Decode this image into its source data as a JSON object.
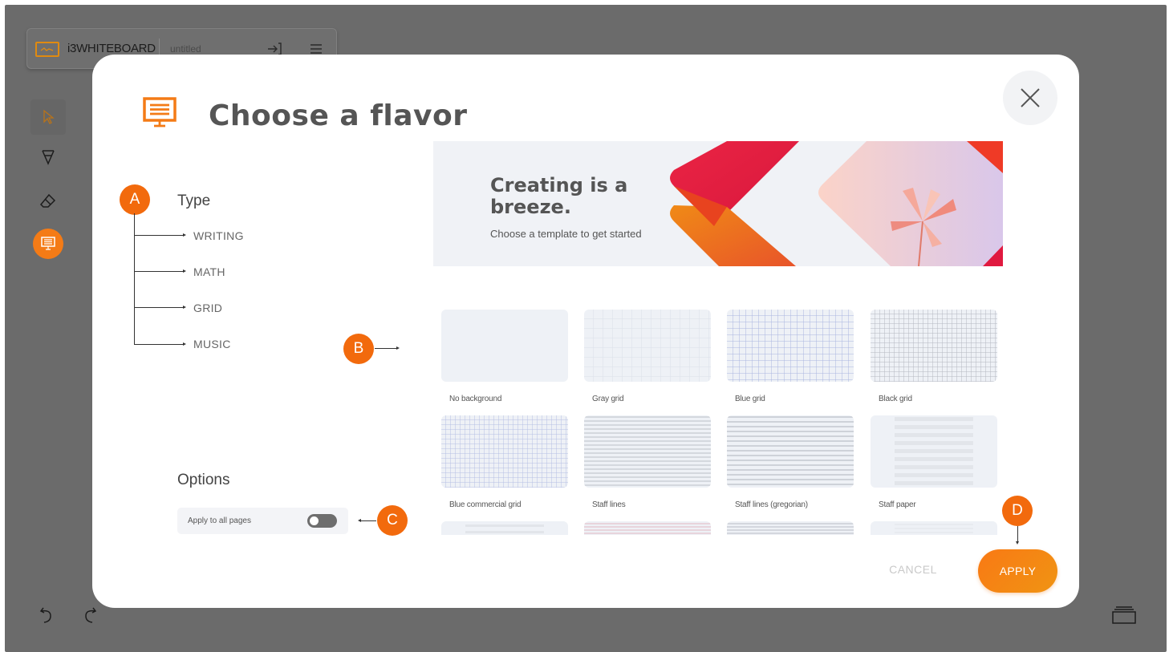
{
  "app": {
    "name": "i3WHITEBOARD",
    "document_name": "untitled"
  },
  "toolbar": {
    "tools": [
      "cursor-icon",
      "pen-icon",
      "eraser-icon",
      "flavor-icon"
    ],
    "active_tool": "flavor-icon"
  },
  "modal": {
    "title": "Choose a flavor",
    "type_heading": "Type",
    "types": [
      "WRITING",
      "MATH",
      "GRID",
      "MUSIC"
    ],
    "banner": {
      "title": "Creating is a breeze.",
      "subtitle": "Choose a template to get started"
    },
    "templates": [
      {
        "label": "No background",
        "pattern": "none"
      },
      {
        "label": "Gray grid",
        "pattern": "gray-grid"
      },
      {
        "label": "Blue grid",
        "pattern": "blue-grid"
      },
      {
        "label": "Black grid",
        "pattern": "black-grid"
      },
      {
        "label": "Blue commercial grid",
        "pattern": "blue-commercial-grid"
      },
      {
        "label": "Staff lines",
        "pattern": "staff-lines"
      },
      {
        "label": "Staff lines (gregorian)",
        "pattern": "staff-lines-gregorian"
      },
      {
        "label": "Staff paper",
        "pattern": "staff-paper"
      }
    ],
    "options_heading": "Options",
    "apply_all_label": "Apply to all pages",
    "apply_all_enabled": false,
    "cancel_label": "CANCEL",
    "apply_label": "APPLY"
  },
  "annotations": {
    "a": "A",
    "b": "B",
    "c": "C",
    "d": "D"
  },
  "colors": {
    "accent": "#f47b16",
    "overlay": "#6b6b6b",
    "banner_red": "#e01f45",
    "banner_orange": "#f07a15"
  }
}
